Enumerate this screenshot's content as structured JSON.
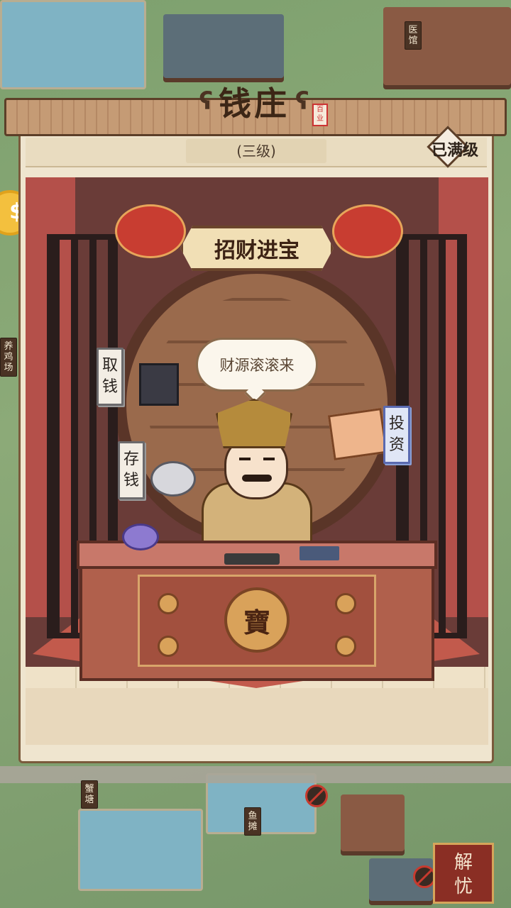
{
  "building": {
    "title": "钱庄",
    "seal": "百业",
    "level": "(三级)",
    "status": "已满级"
  },
  "scene": {
    "banner": "招财进宝",
    "speech": "财源滚滚来",
    "emblem": "寶",
    "buttons": {
      "withdraw": "取钱",
      "deposit": "存钱",
      "invest": "投资"
    }
  },
  "map_signs": {
    "chicken_farm": "养鸡场",
    "crab_pond": "蟹塘",
    "fish_stall": "鱼摊",
    "clinic": "医馆"
  },
  "corner_button": "解忧"
}
